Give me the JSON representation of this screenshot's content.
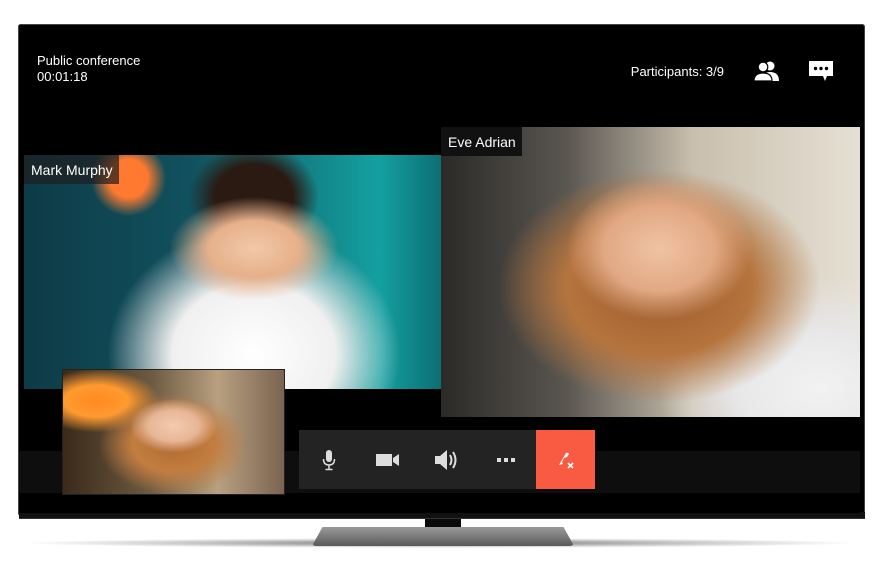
{
  "header": {
    "title": "Public conference",
    "timer": "00:01:18",
    "participants_label": "Participants: 3/9",
    "participants_icon": "people-icon",
    "chat_icon": "chat-icon"
  },
  "videos": [
    {
      "name": "Mark Murphy"
    },
    {
      "name": "Eve Adrian"
    },
    {
      "name": ""
    }
  ],
  "controls": [
    {
      "icon": "microphone-icon"
    },
    {
      "icon": "camera-icon"
    },
    {
      "icon": "speaker-icon"
    },
    {
      "icon": "more-icon"
    },
    {
      "icon": "end-call-icon"
    }
  ],
  "colors": {
    "end_call": "#f95a42",
    "control_bar": "#232323",
    "screen_bg": "#000000"
  }
}
